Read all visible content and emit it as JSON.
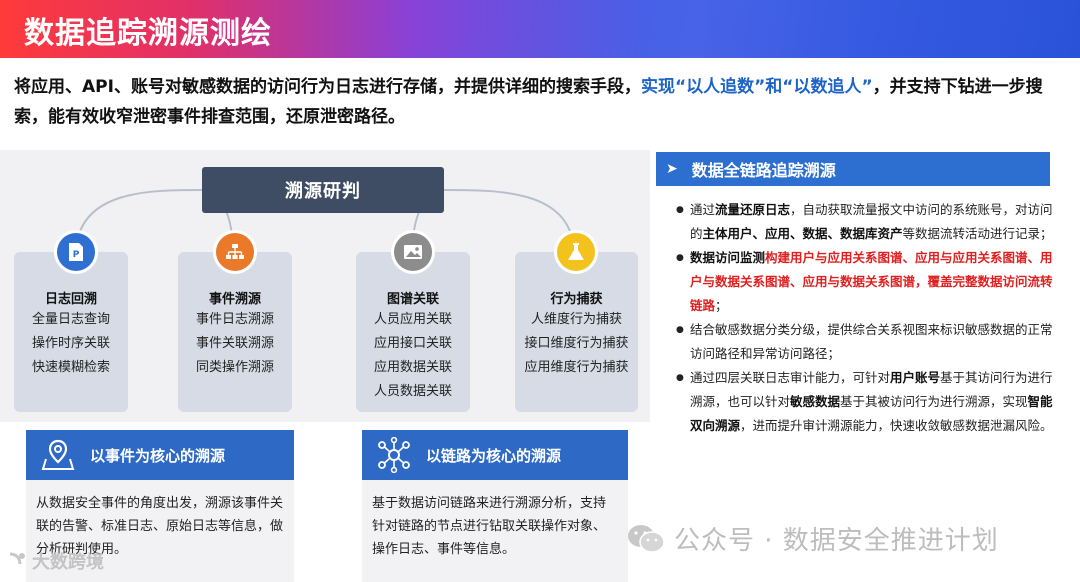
{
  "banner": {
    "title": "数据追踪溯源测绘"
  },
  "intro": {
    "part1": "将应用、API、账号对敏感数据的访问行为日志进行存储，并提供详细的搜索手段，",
    "part2": "实现“以人追数”和“以数追人”",
    "part3": "，并支持下钻进一步搜索，能有效收窄泄密事件排查范围，还原泄密路径。"
  },
  "center": {
    "label": "溯源研判"
  },
  "cards": [
    {
      "title": "日志回溯",
      "icon": "document-icon",
      "color": "#2f6fd1",
      "items": [
        "全量日志查询",
        "操作时序关联",
        "快速模糊检索"
      ]
    },
    {
      "title": "事件溯源",
      "icon": "hierarchy-icon",
      "color": "#ea7a2a",
      "items": [
        "事件日志溯源",
        "事件关联溯源",
        "同类操作溯源"
      ]
    },
    {
      "title": "图谱关联",
      "icon": "image-icon",
      "color": "#8c8c8c",
      "items": [
        "人员应用关联",
        "应用接口关联",
        "应用数据关联",
        "人员数据关联"
      ]
    },
    {
      "title": "行为捕获",
      "icon": "flask-icon",
      "color": "#f3c21c",
      "items": [
        "人维度行为捕获",
        "接口维度行为捕获",
        "应用维度行为捕获"
      ]
    }
  ],
  "boxes": [
    {
      "title": "以事件为核心的溯源",
      "icon": "map-pin-icon",
      "body": "从数据安全事件的角度出发，溯源该事件关联的告警、标准日志、原始日志等信息，做分析研判使用。"
    },
    {
      "title": "以链路为核心的溯源",
      "icon": "network-icon",
      "body": "基于数据访问链路来进行溯源分析，支持针对链路的节点进行钻取关联操作对象、操作日志、事件等信息。"
    }
  ],
  "right": {
    "heading": "数据全链路追踪溯源",
    "b1": {
      "t1": "通过",
      "k1": "流量还原日志",
      "t2": "，自动获取流量报文中访问的系统账号，对访问的",
      "k2": "主体用户、应用、数据、数据库资产",
      "t3": "等数据流转活动进行记录；"
    },
    "b2": {
      "k1": "数据访问监测",
      "r1": "构建用户与应用关系图谱、应用与应用关系图谱、用户与数据关系图谱、应用与数据关系图谱，覆盖完整数据访问流转链路",
      "t1": "；"
    },
    "b3": {
      "t1": "结合敏感数据分类分级，提供综合关系视图来标识敏感数据的正常访问路径和异常访问路径；"
    },
    "b4": {
      "t1": "通过四层关联日志审计能力，可针对",
      "k1": "用户账号",
      "t2": "基于其访问行为进行溯源，也可以针对",
      "k2": "敏感数据",
      "t3": "基于其被访问行为进行溯源，实现",
      "k3": "智能双向溯源",
      "t4": "，进而提升审计溯源能力，快速收敛敏感数据泄漏风险。"
    }
  },
  "watermark": {
    "right": "公众号 · 数据安全推进计划",
    "left": "大数跨境"
  }
}
